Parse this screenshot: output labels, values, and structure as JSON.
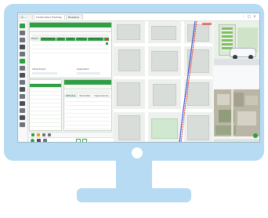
{
  "app": {
    "tabs": [
      {
        "label": "Ⓖ ..."
      },
      {
        "label": "Construction Tracking"
      },
      {
        "label": "Bluebase"
      }
    ],
    "active_tab_index": 1,
    "window_controls": [
      "–",
      "□",
      "×"
    ]
  },
  "tree_panel": {
    "title": "Construction Tracking",
    "tabs": [
      "Project",
      "Performance",
      "Tasks",
      "Agent",
      "Tracking",
      "Attachments"
    ],
    "footer": {
      "left_label": "Global Project",
      "right_label": "Organization"
    }
  },
  "property_panel": {
    "title": "",
    "tabs": [
      "Attributes",
      "Parameters",
      "Dependencies"
    ]
  },
  "colors": {
    "accent": "#2f9e44",
    "route_blue": "#3b5bdb",
    "route_red": "#e03131"
  },
  "icons": [
    "select-tool-icon",
    "move-tool-icon",
    "measure-icon",
    "layers-icon",
    "camera-icon",
    "add-icon",
    "settings-icon"
  ]
}
